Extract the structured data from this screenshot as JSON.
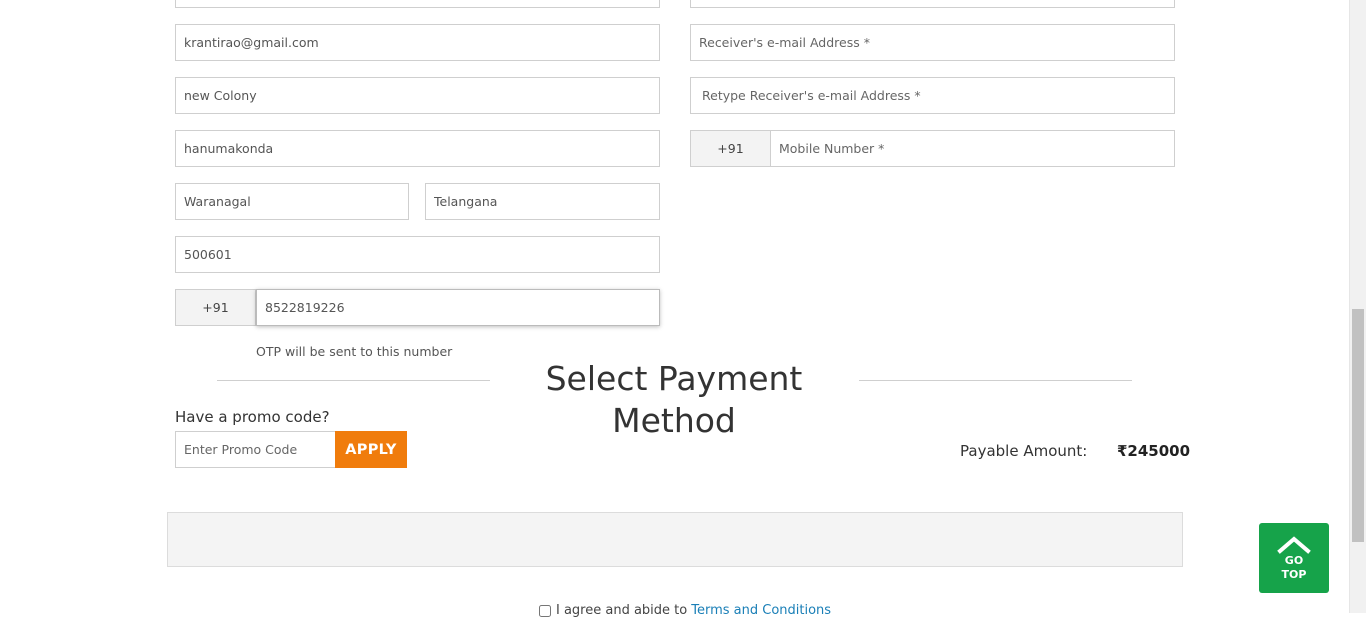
{
  "sender": {
    "email": "krantirao@gmail.com",
    "address": "new Colony",
    "area": "hanumakonda",
    "city": "Waranagal",
    "state": "Telangana",
    "pincode": "500601",
    "country_code": "+91",
    "mobile": "8522819226",
    "otp_note": "OTP will be sent to this number"
  },
  "receiver": {
    "email_placeholder": "Receiver's e-mail Address *",
    "retype_email_placeholder": "Retype Receiver's e-mail Address *",
    "country_code": "+91",
    "mobile_placeholder": "Mobile Number *"
  },
  "payment": {
    "title": "Select Payment Method",
    "promo_label": "Have a promo code?",
    "promo_placeholder": "Enter Promo Code",
    "apply_label": "APPLY",
    "payable_label": "Payable Amount:",
    "payable_value": "₹245000"
  },
  "terms": {
    "text": "I agree and abide to",
    "link": "Terms and Conditions"
  },
  "go_top": {
    "line1": "GO",
    "line2": "TOP",
    "icon": "chevron-up-icon"
  },
  "colors": {
    "apply": "#f07c0c",
    "go_top": "#16a34a",
    "link": "#1a7fb7"
  }
}
